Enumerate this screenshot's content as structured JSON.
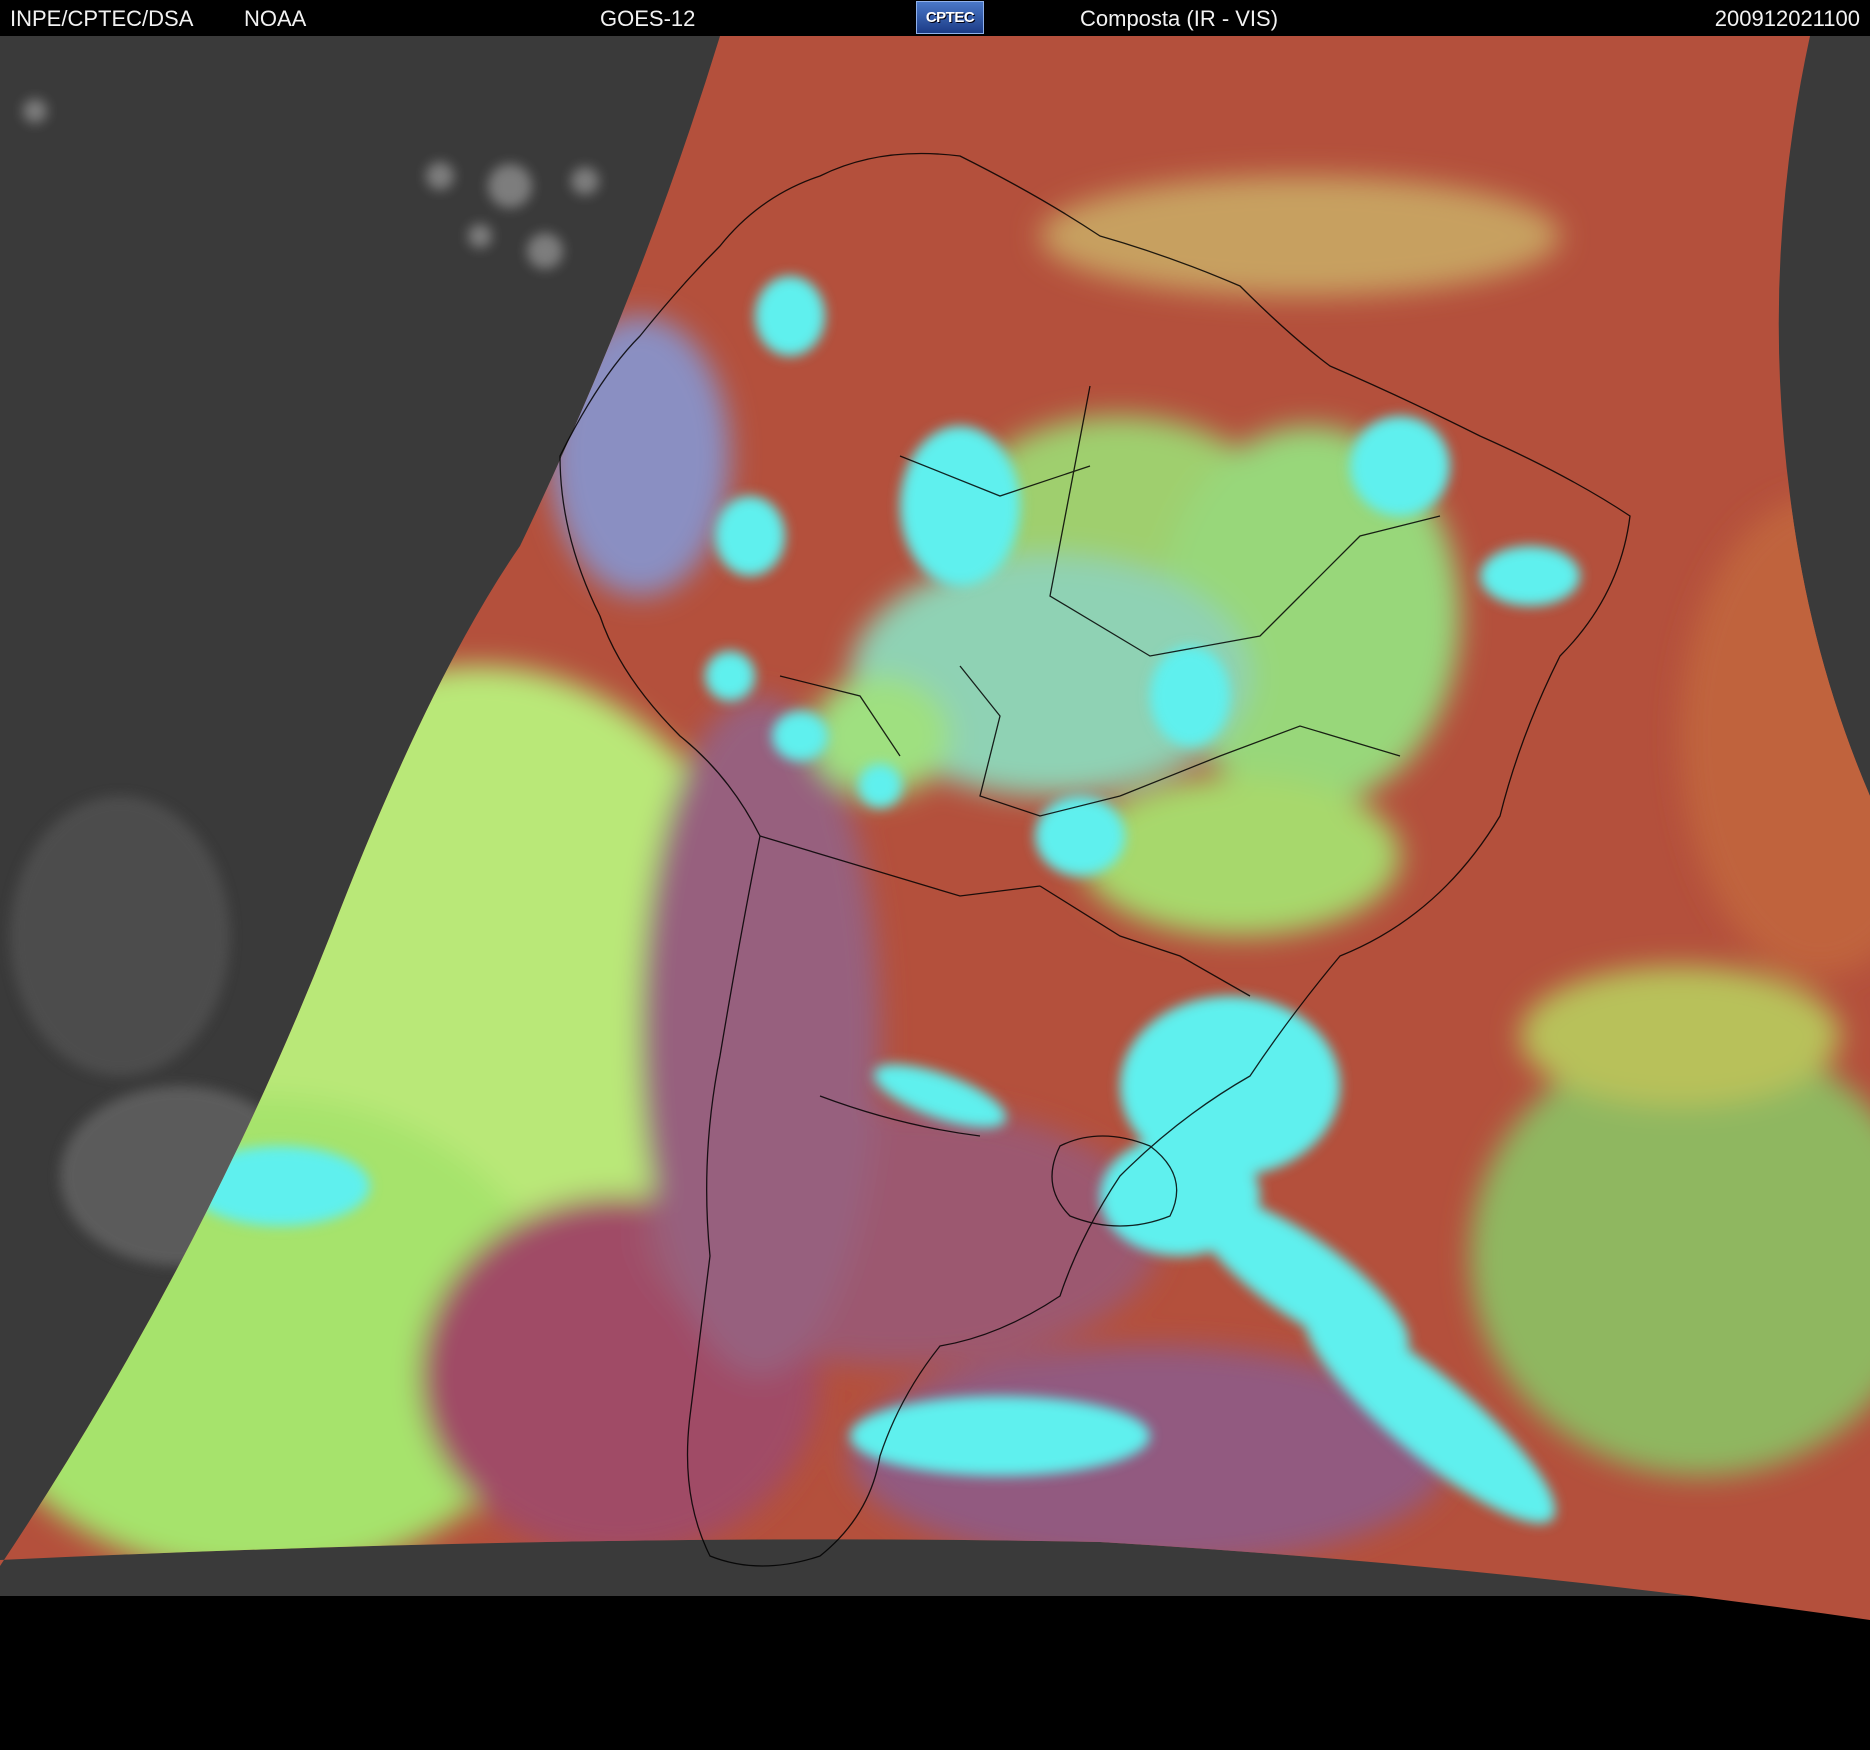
{
  "header": {
    "organization": "INPE/CPTEC/DSA",
    "agency": "NOAA",
    "satellite": "GOES-12",
    "logo_text": "CPTEC",
    "product": "Composta (IR - VIS)",
    "timestamp": "200912021100"
  },
  "map": {
    "background_color": "#000000",
    "night_side_color": "#3a3a3a",
    "palette": {
      "clear_land_ocean": "#b4503c",
      "low_cloud": "#9ee36a",
      "high_cold_cloud": "#5ff0ee",
      "mid_cloud": "#8e5a78",
      "border_lines": "#000000"
    }
  }
}
